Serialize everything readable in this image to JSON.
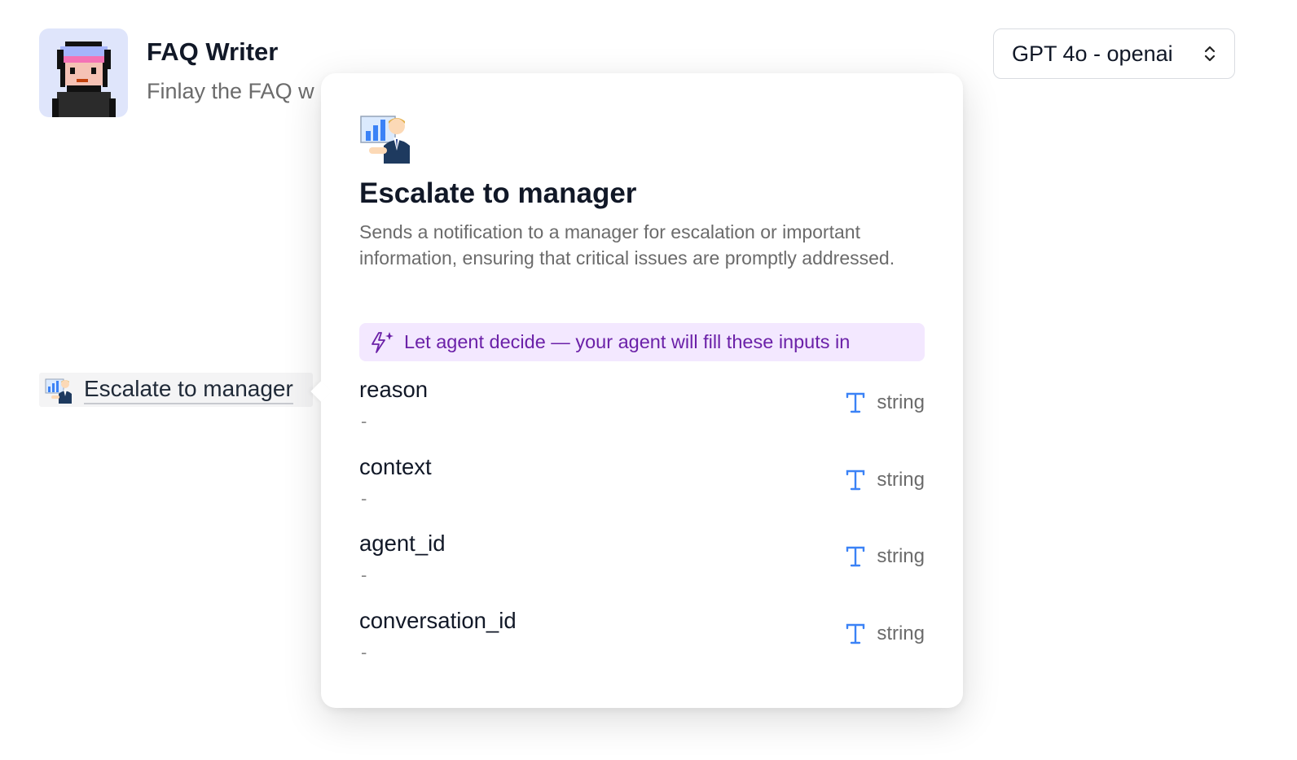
{
  "agent": {
    "name": "FAQ Writer",
    "description": "Finlay the FAQ w"
  },
  "model_select": {
    "value": "GPT 4o - openai"
  },
  "tool_chip": {
    "label": "Escalate to manager",
    "icon": "manager-presenting-icon"
  },
  "popover": {
    "icon": "manager-presenting-icon",
    "title": "Escalate to manager",
    "description": "Sends a notification to a manager for escalation or important information, ensuring that critical issues are promptly addressed.",
    "banner": {
      "icon": "sparkle-lightning-icon",
      "text": "Let agent decide — your agent will fill these inputs in",
      "bg_color": "#f3e8ff",
      "text_color": "#6b21a8"
    },
    "params": [
      {
        "name": "reason",
        "value": "-",
        "type": "string",
        "type_icon": "text-type-icon"
      },
      {
        "name": "context",
        "value": "-",
        "type": "string",
        "type_icon": "text-type-icon"
      },
      {
        "name": "agent_id",
        "value": "-",
        "type": "string",
        "type_icon": "text-type-icon"
      },
      {
        "name": "conversation_id",
        "value": "-",
        "type": "string",
        "type_icon": "text-type-icon"
      }
    ]
  },
  "colors": {
    "type_icon": "#3b82f6",
    "avatar_bg": "#dfe5fb"
  }
}
